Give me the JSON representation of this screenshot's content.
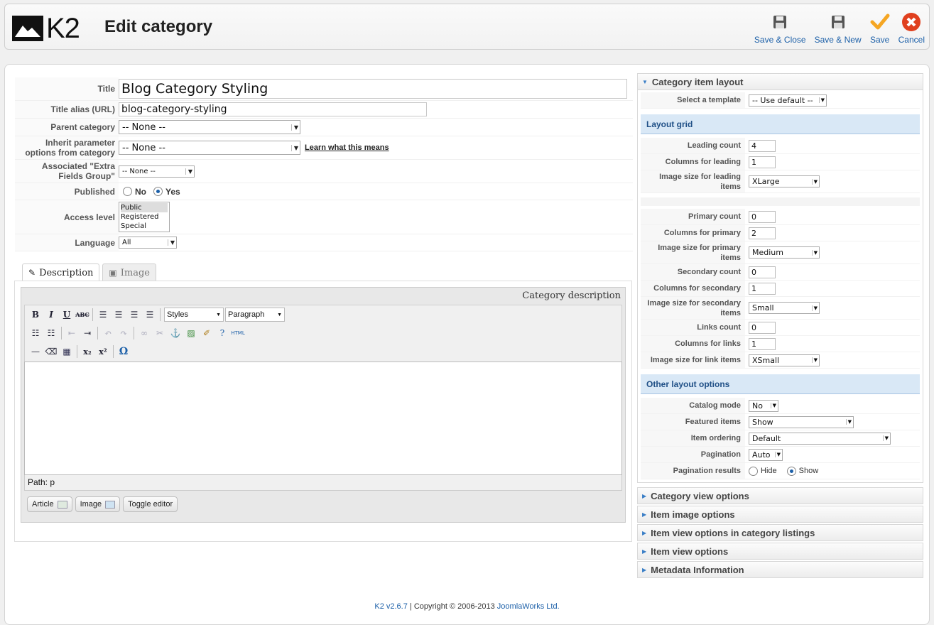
{
  "header": {
    "logo_text": "K2",
    "title": "Edit category",
    "buttons": [
      {
        "label": "Save & Close",
        "icon": "save-icon"
      },
      {
        "label": "Save & New",
        "icon": "save-icon"
      },
      {
        "label": "Save",
        "icon": "check-icon"
      },
      {
        "label": "Cancel",
        "icon": "cancel-icon"
      }
    ]
  },
  "form": {
    "title_label": "Title",
    "title_value": "Blog Category Styling",
    "alias_label": "Title alias (URL)",
    "alias_value": "blog-category-styling",
    "parent_label": "Parent category",
    "parent_value": "-- None --",
    "inherit_label": "Inherit parameter options from category",
    "inherit_value": "-- None --",
    "learn_link": "Learn what this means",
    "extra_label": "Associated \"Extra Fields Group\"",
    "extra_value": "-- None --",
    "published_label": "Published",
    "published_no": "No",
    "published_yes": "Yes",
    "access_label": "Access level",
    "access_options": [
      "Public",
      "Registered",
      "Special"
    ],
    "language_label": "Language",
    "language_value": "All"
  },
  "tabs": [
    {
      "label": "Description",
      "icon": "edit-icon"
    },
    {
      "label": "Image",
      "icon": "image-icon"
    }
  ],
  "editor": {
    "caption": "Category description",
    "styles_value": "Styles",
    "format_value": "Paragraph",
    "html_label": "HTML",
    "path": "Path: p",
    "buttons": [
      "Article",
      "Image",
      "Toggle editor"
    ]
  },
  "right": {
    "layout_header": "Category item layout",
    "template_label": "Select a template",
    "template_value": "-- Use default --",
    "grid_header": "Layout grid",
    "leading_count_label": "Leading count",
    "leading_count": "4",
    "columns_leading_label": "Columns for leading",
    "columns_leading": "1",
    "img_leading_label": "Image size for leading items",
    "img_leading": "XLarge",
    "primary_count_label": "Primary count",
    "primary_count": "0",
    "columns_primary_label": "Columns for primary",
    "columns_primary": "2",
    "img_primary_label": "Image size for primary items",
    "img_primary": "Medium",
    "secondary_count_label": "Secondary count",
    "secondary_count": "0",
    "columns_secondary_label": "Columns for secondary",
    "columns_secondary": "1",
    "img_secondary_label": "Image size for secondary items",
    "img_secondary": "Small",
    "links_count_label": "Links count",
    "links_count": "0",
    "columns_links_label": "Columns for links",
    "columns_links": "1",
    "img_links_label": "Image size for link items",
    "img_links": "XSmall",
    "other_header": "Other layout options",
    "catalog_label": "Catalog mode",
    "catalog_value": "No",
    "featured_label": "Featured items",
    "featured_value": "Show",
    "ordering_label": "Item ordering",
    "ordering_value": "Default",
    "pagination_label": "Pagination",
    "pagination_value": "Auto",
    "pag_results_label": "Pagination results",
    "pag_hide": "Hide",
    "pag_show": "Show",
    "collapsed_sections": [
      "Category view options",
      "Item image options",
      "Item view options in category listings",
      "Item view options",
      "Metadata Information"
    ]
  },
  "footer": {
    "version_link": "K2 v2.6.7",
    "copyright": " | Copyright © 2006-2013 ",
    "company_link": "JoomlaWorks Ltd."
  },
  "colors": {
    "link_blue": "#1b5fa8",
    "subhead_bg": "#d9e8f6",
    "save_check": "#f5a623",
    "cancel_red": "#e0401e"
  }
}
